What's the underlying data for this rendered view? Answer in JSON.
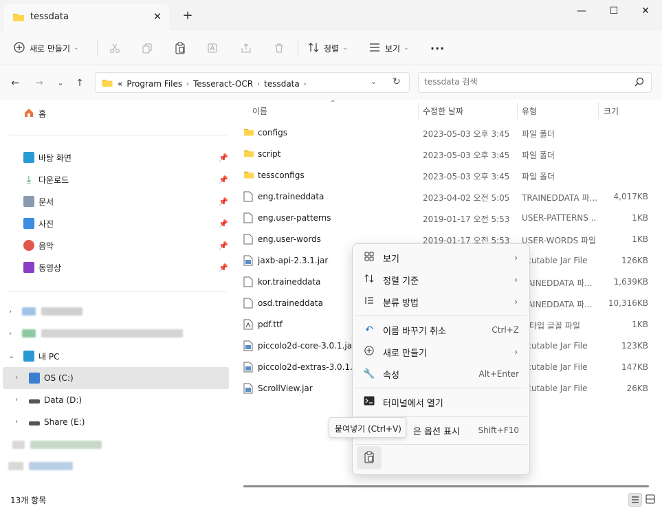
{
  "tab": {
    "title": "tessdata"
  },
  "window": {
    "minimize": "—",
    "maximize": "☐",
    "close": "✕"
  },
  "toolbar": {
    "new_label": "새로 만들기",
    "sort_label": "정렬",
    "view_label": "보기",
    "more": "···"
  },
  "address": {
    "crumbs": [
      "Program Files",
      "Tesseract-OCR",
      "tessdata"
    ],
    "prefix": "«"
  },
  "search": {
    "placeholder": "tessdata 검색"
  },
  "sidebar": {
    "home": "홈",
    "quick": [
      {
        "label": "바탕 화면",
        "icon": "desktop-icon"
      },
      {
        "label": "다운로드",
        "icon": "download-icon"
      },
      {
        "label": "문서",
        "icon": "documents-icon"
      },
      {
        "label": "사진",
        "icon": "pictures-icon"
      },
      {
        "label": "음악",
        "icon": "music-icon"
      },
      {
        "label": "동영상",
        "icon": "videos-icon"
      }
    ],
    "this_pc": "내 PC",
    "drives": [
      {
        "label": "OS (C:)"
      },
      {
        "label": "Data (D:)"
      },
      {
        "label": "Share (E:)"
      }
    ]
  },
  "columns": {
    "name": "이름",
    "date": "수정한 날짜",
    "type": "유형",
    "size": "크기"
  },
  "files": [
    {
      "name": "configs",
      "date": "2023-05-03 오후 3:45",
      "type": "파일 폴더",
      "size": "",
      "kind": "folder"
    },
    {
      "name": "script",
      "date": "2023-05-03 오후 3:45",
      "type": "파일 폴더",
      "size": "",
      "kind": "folder"
    },
    {
      "name": "tessconfigs",
      "date": "2023-05-03 오후 3:45",
      "type": "파일 폴더",
      "size": "",
      "kind": "folder"
    },
    {
      "name": "eng.traineddata",
      "date": "2023-04-02 오전 5:05",
      "type": "TRAINEDDATA 파...",
      "size": "4,017KB",
      "kind": "file"
    },
    {
      "name": "eng.user-patterns",
      "date": "2019-01-17 오전 5:53",
      "type": "USER-PATTERNS ...",
      "size": "1KB",
      "kind": "file"
    },
    {
      "name": "eng.user-words",
      "date": "2019-01-17 오전 5:53",
      "type": "USER-WORDS 파일",
      "size": "1KB",
      "kind": "file"
    },
    {
      "name": "jaxb-api-2.3.1.jar",
      "date": "",
      "type": "ecutable Jar File",
      "size": "126KB",
      "kind": "jar"
    },
    {
      "name": "kor.traineddata",
      "date": "",
      "type": "RAINEDDATA 파...",
      "size": "1,639KB",
      "kind": "file"
    },
    {
      "name": "osd.traineddata",
      "date": "",
      "type": "RAINEDDATA 파...",
      "size": "10,316KB",
      "kind": "file"
    },
    {
      "name": "pdf.ttf",
      "date": "",
      "type": "루타입 글꼴 파일",
      "size": "1KB",
      "kind": "font"
    },
    {
      "name": "piccolo2d-core-3.0.1.jar",
      "date": "",
      "type": "ecutable Jar File",
      "size": "123KB",
      "kind": "jar"
    },
    {
      "name": "piccolo2d-extras-3.0.1.jar",
      "date": "",
      "type": "ecutable Jar File",
      "size": "147KB",
      "kind": "jar"
    },
    {
      "name": "ScrollView.jar",
      "date": "",
      "type": "ecutable Jar File",
      "size": "26KB",
      "kind": "jar"
    }
  ],
  "context_menu": {
    "items": [
      {
        "label": "보기",
        "icon": "view-icon",
        "shortcut": "",
        "submenu": true
      },
      {
        "label": "정렬 기준",
        "icon": "sort-icon",
        "shortcut": "",
        "submenu": true
      },
      {
        "label": "분류 방법",
        "icon": "group-icon",
        "shortcut": "",
        "submenu": true
      },
      {
        "label": "이름 바꾸기 취소",
        "icon": "undo-icon",
        "shortcut": "Ctrl+Z",
        "submenu": false
      },
      {
        "label": "새로 만들기",
        "icon": "new-icon",
        "shortcut": "",
        "submenu": true
      },
      {
        "label": "속성",
        "icon": "properties-icon",
        "shortcut": "Alt+Enter",
        "submenu": false
      },
      {
        "label": "터미널에서 열기",
        "icon": "terminal-icon",
        "shortcut": "",
        "submenu": false
      },
      {
        "label": "은 옵션 표시",
        "icon": "more-options-icon",
        "shortcut": "Shift+F10",
        "submenu": false
      }
    ],
    "tooltip": "붙여넣기 (Ctrl+V)"
  },
  "status": {
    "count": "13개 항목"
  }
}
